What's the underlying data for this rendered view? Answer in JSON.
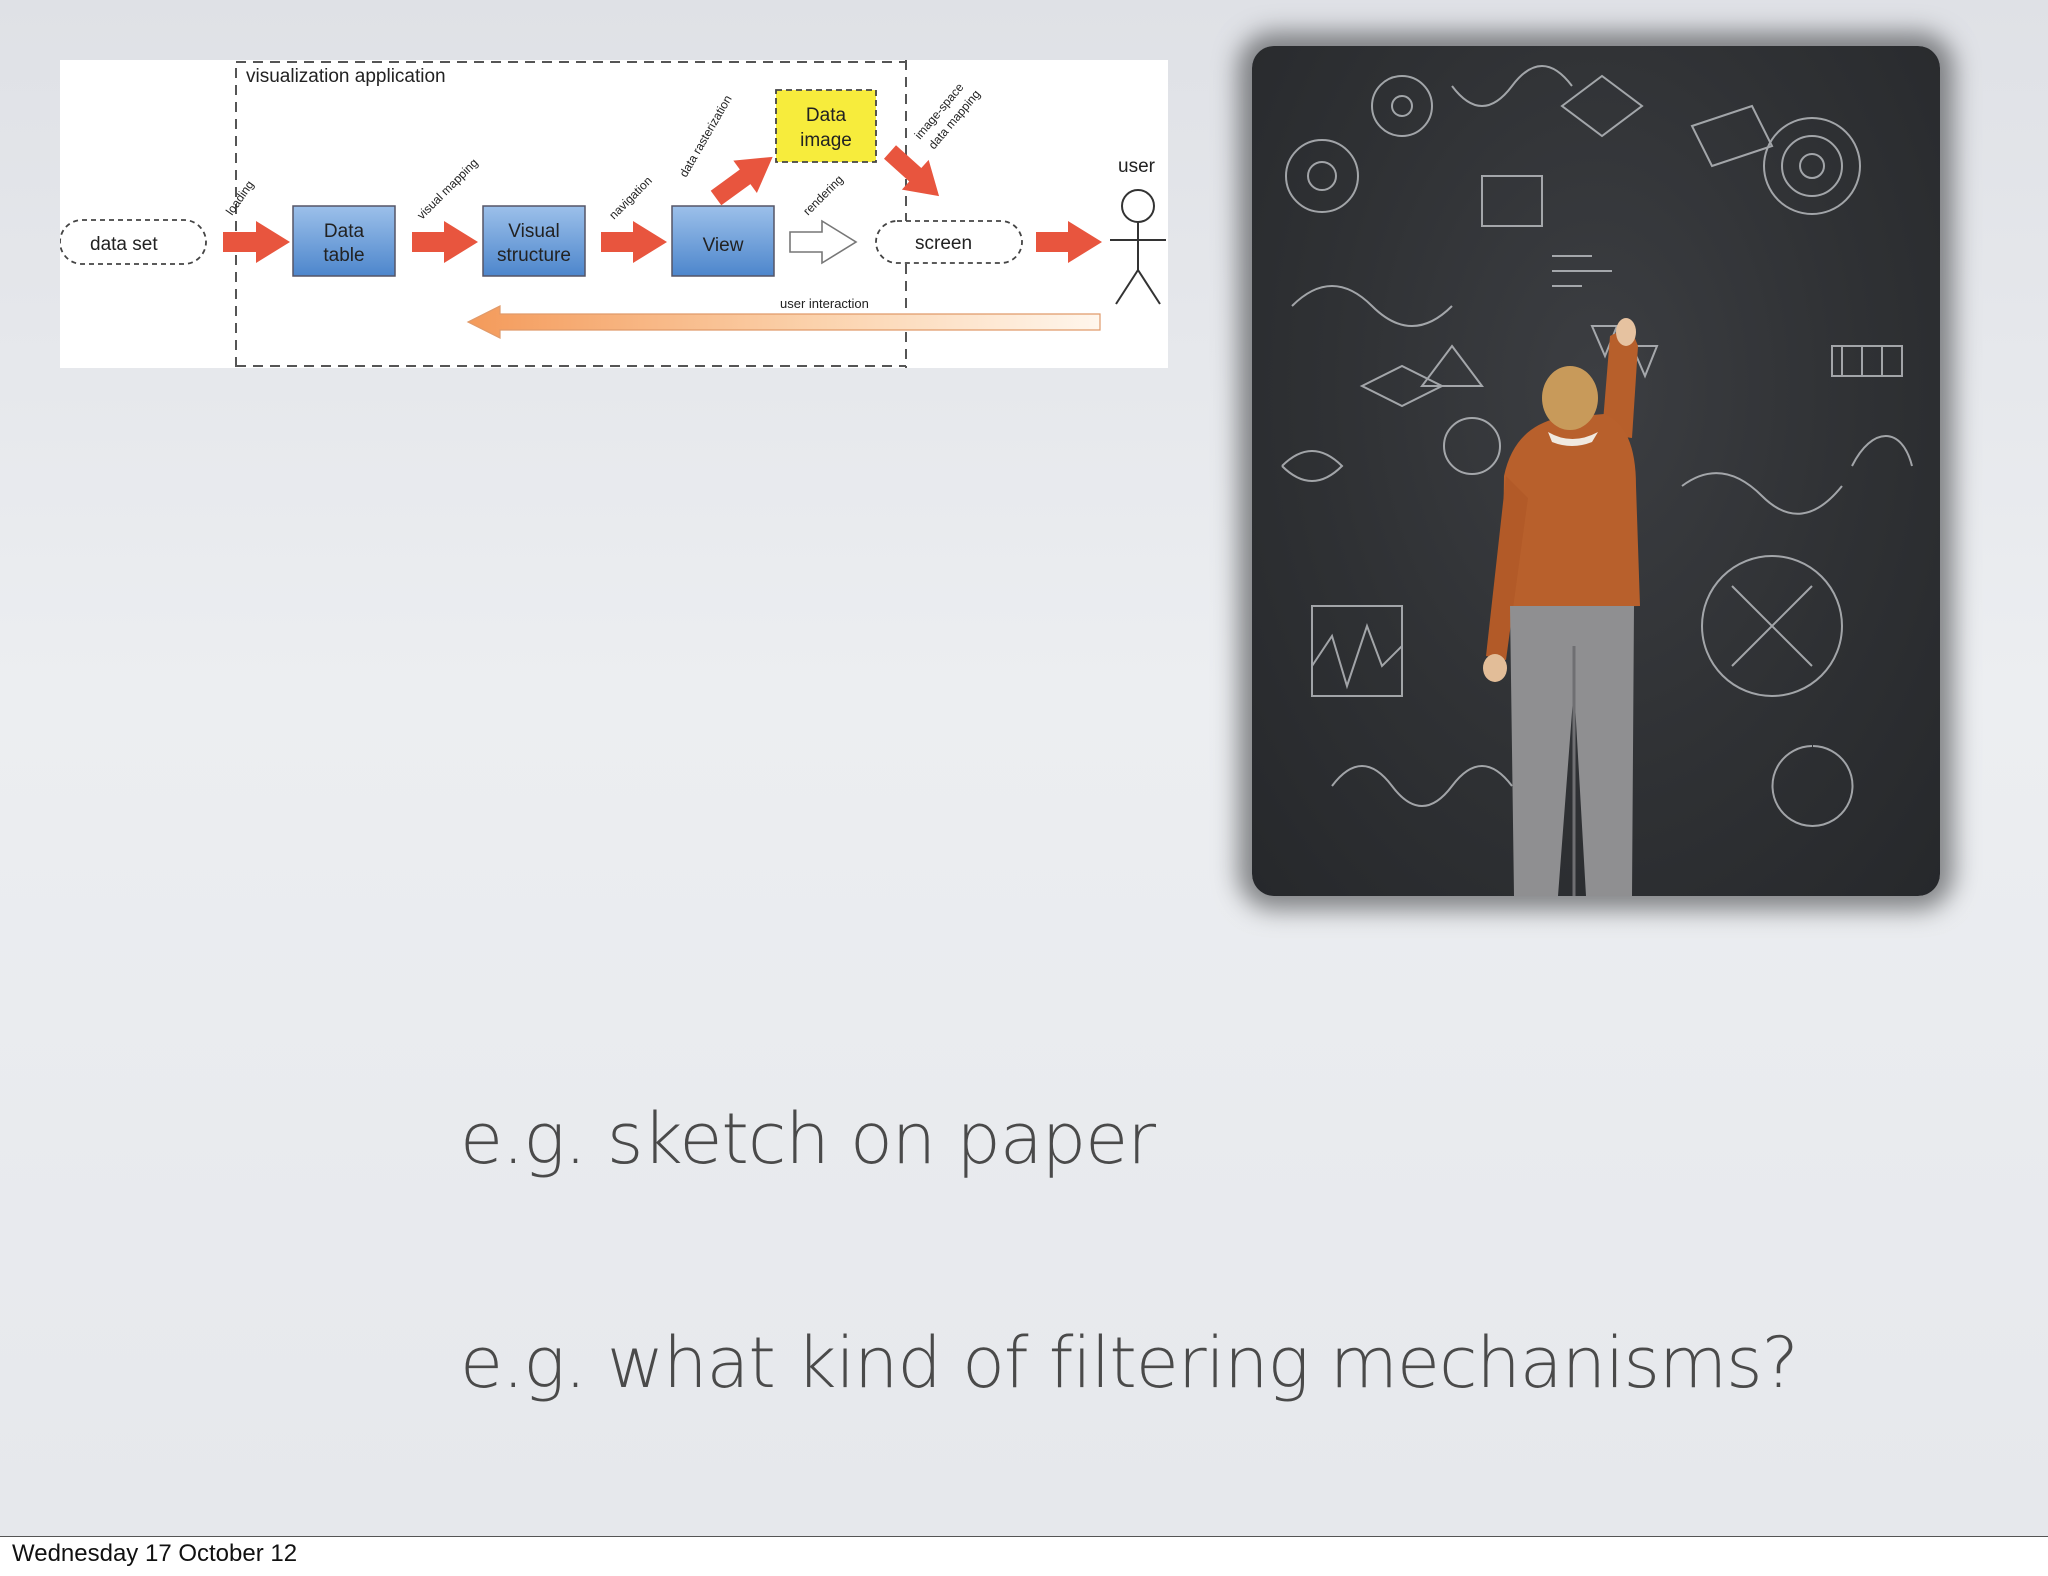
{
  "slide": {
    "bullets": [
      "e.g. sketch on paper",
      "e.g. what kind of filtering mechanisms?"
    ],
    "footer_date": "Wednesday 17 October 12"
  },
  "pipeline_diagram": {
    "container_label": "visualization application",
    "nodes": {
      "data_set": "data set",
      "data_table": [
        "Data",
        "table"
      ],
      "visual_structure": [
        "Visual",
        "structure"
      ],
      "view": "View",
      "data_image": [
        "Data",
        "image"
      ],
      "screen": "screen",
      "user": "user"
    },
    "edges": {
      "loading": "loading",
      "visual_mapping": "visual mapping",
      "navigation": "navigation",
      "data_rasterization": "data rasterization",
      "rendering": "rendering",
      "image_space_mapping": [
        "image-space",
        "data mapping"
      ],
      "user_interaction": "user interaction"
    },
    "colors": {
      "arrow": "#e8553e",
      "node_blue": "#5f93d2",
      "node_yellow": "#f7ec3c",
      "feedback_arrow": "#f5a062"
    }
  },
  "photo": {
    "subject": "man-drawing-on-chalkboard"
  }
}
